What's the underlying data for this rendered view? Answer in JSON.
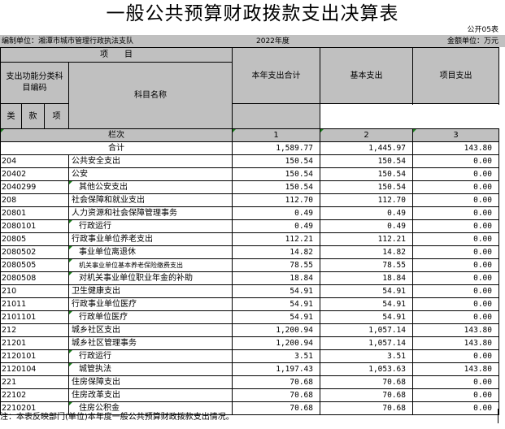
{
  "title": "一般公共预算财政拨款支出决算表",
  "form_no": "公开05表",
  "unit": "编制单位：湘潭市城市管理行政执法支队",
  "year": "2022年度",
  "currency": "金额单位：万元",
  "header": {
    "item": "项　　目",
    "func_code": "支出功能分类科目编码",
    "name": "科目名称",
    "total": "本年支出合计",
    "basic": "基本支出",
    "project": "项目支出",
    "lei": "类",
    "kuan": "款",
    "xiang": "项",
    "lanci": "栏次",
    "col1": "1",
    "col2": "2",
    "col3": "3"
  },
  "totals": {
    "label": "合计",
    "total": "1,589.77",
    "basic": "1,445.97",
    "project": "143.80"
  },
  "rows": [
    {
      "code": "204",
      "name": "公共安全支出",
      "level": 1,
      "total": "150.54",
      "basic": "150.54",
      "project": "0.00"
    },
    {
      "code": "20402",
      "name": "公安",
      "level": 2,
      "total": "150.54",
      "basic": "150.54",
      "project": "0.00"
    },
    {
      "code": "2040299",
      "name": "其他公安支出",
      "level": 3,
      "total": "150.54",
      "basic": "150.54",
      "project": "0.00"
    },
    {
      "code": "208",
      "name": "社会保障和就业支出",
      "level": 1,
      "total": "112.70",
      "basic": "112.70",
      "project": "0.00"
    },
    {
      "code": "20801",
      "name": "人力资源和社会保障管理事务",
      "level": 2,
      "total": "0.49",
      "basic": "0.49",
      "project": "0.00"
    },
    {
      "code": "2080101",
      "name": "行政运行",
      "level": 3,
      "total": "0.49",
      "basic": "0.49",
      "project": "0.00"
    },
    {
      "code": "20805",
      "name": "行政事业单位养老支出",
      "level": 2,
      "total": "112.21",
      "basic": "112.21",
      "project": "0.00"
    },
    {
      "code": "2080502",
      "name": "事业单位离退休",
      "level": 3,
      "total": "14.82",
      "basic": "14.82",
      "project": "0.00"
    },
    {
      "code": "2080505",
      "name": "机关事业单位基本养老保险缴费支出",
      "level": 3,
      "small": true,
      "total": "78.55",
      "basic": "78.55",
      "project": "0.00"
    },
    {
      "code": "2080508",
      "name": "对机关事业单位职业年金的补助",
      "level": 3,
      "total": "18.84",
      "basic": "18.84",
      "project": "0.00"
    },
    {
      "code": "210",
      "name": "卫生健康支出",
      "level": 1,
      "total": "54.91",
      "basic": "54.91",
      "project": "0.00"
    },
    {
      "code": "21011",
      "name": "行政事业单位医疗",
      "level": 2,
      "total": "54.91",
      "basic": "54.91",
      "project": "0.00"
    },
    {
      "code": "2101101",
      "name": "行政单位医疗",
      "level": 3,
      "total": "54.91",
      "basic": "54.91",
      "project": "0.00"
    },
    {
      "code": "212",
      "name": "城乡社区支出",
      "level": 1,
      "total": "1,200.94",
      "basic": "1,057.14",
      "project": "143.80"
    },
    {
      "code": "21201",
      "name": "城乡社区管理事务",
      "level": 2,
      "total": "1,200.94",
      "basic": "1,057.14",
      "project": "143.80"
    },
    {
      "code": "2120101",
      "name": "行政运行",
      "level": 3,
      "total": "3.51",
      "basic": "3.51",
      "project": "0.00"
    },
    {
      "code": "2120104",
      "name": "城管执法",
      "level": 3,
      "total": "1,197.43",
      "basic": "1,053.63",
      "project": "143.80"
    },
    {
      "code": "221",
      "name": "住房保障支出",
      "level": 1,
      "total": "70.68",
      "basic": "70.68",
      "project": "0.00"
    },
    {
      "code": "22102",
      "name": "住房改革支出",
      "level": 2,
      "total": "70.68",
      "basic": "70.68",
      "project": "0.00"
    },
    {
      "code": "2210201",
      "name": "住房公积金",
      "level": 3,
      "total": "70.68",
      "basic": "70.68",
      "project": "0.00"
    }
  ],
  "note": "注：本表反映部门(单位)本年度一般公共预算财政拨款支出情况。"
}
